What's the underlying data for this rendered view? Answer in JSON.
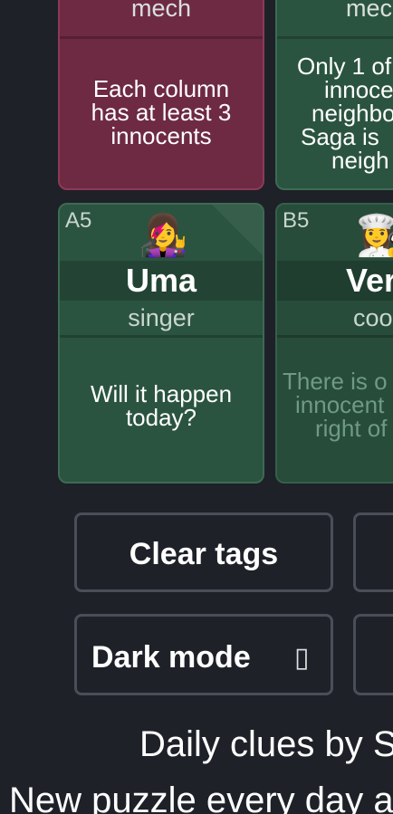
{
  "top_row": [
    {
      "role": "mech",
      "clue": [
        "Each column",
        "has at least 3",
        "innocents"
      ],
      "color": "#6e2a42"
    },
    {
      "role": "mec",
      "clue": [
        "Only 1 of",
        "innoce",
        "neighbo",
        "Saga is",
        "neigh"
      ],
      "color": "#2b5440"
    }
  ],
  "cards": [
    {
      "coord": "A5",
      "emoji": "👩‍🎤",
      "name": "Uma",
      "profession": "singer",
      "clue": [
        "Will it happen",
        "today?"
      ]
    },
    {
      "coord": "B5",
      "emoji": "👩‍🍳",
      "name": "Ver",
      "profession": "coo",
      "clue": [
        "There is o",
        "innocent",
        "right of"
      ]
    }
  ],
  "buttons": {
    "clear_tags": "Clear tags",
    "dark_mode": "Dark mode",
    "dark_mode_toggle": "▯"
  },
  "footer": {
    "line1": "Daily clues by S",
    "line2": "New puzzle every day a"
  },
  "colors": {
    "background": "#1e2128",
    "innocent_card": "#2b5440",
    "criminal_card": "#6e2a42",
    "button_border": "#4a4e58"
  }
}
